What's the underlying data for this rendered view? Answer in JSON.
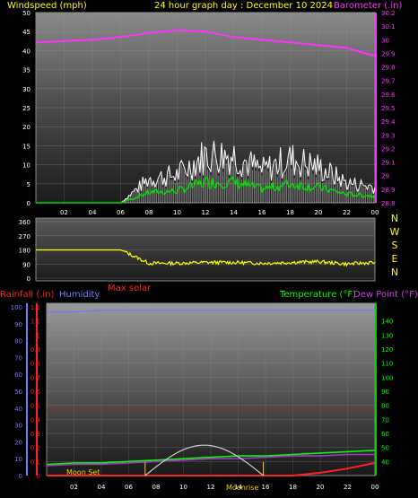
{
  "header": {
    "wind_title": "Windspeed (mph)",
    "graph_title": "24 hour graph day : December 10 2024",
    "baro_title": "Barometer (.in)"
  },
  "lower_header": {
    "rain_title": "Rainfall (.in)",
    "hum_title": "Humidity",
    "solar_title": "Max solar",
    "temp_title": "Temperature (°F)",
    "dew_title": "Dew Point (°F)"
  },
  "time_labels": [
    "02",
    "04",
    "06",
    "08",
    "10",
    "12",
    "14",
    "16",
    "18",
    "20",
    "22",
    "00"
  ],
  "compass_labels": [
    "N",
    "W",
    "S",
    "E",
    "N"
  ],
  "moon": {
    "set_label": "Moon Set",
    "rise_label": "Moonrise"
  },
  "colors": {
    "wind": "#ffffff",
    "gust": "#00dd00",
    "barometer": "#ff33ff",
    "direction": "#ffff00",
    "rain": "#ff2222",
    "humidity": "#7777ff",
    "temperature": "#00ff00",
    "dewpoint": "#aa33cc",
    "solar": "#cccccc",
    "compass": "#ffff00"
  },
  "chart_data": [
    {
      "type": "line",
      "name": "wind-barometer",
      "x": [
        "00",
        "02",
        "04",
        "06",
        "08",
        "10",
        "12",
        "14",
        "16",
        "18",
        "20",
        "22",
        "00"
      ],
      "left_axis": {
        "label": "Windspeed (mph)",
        "range": [
          0,
          50
        ],
        "ticks": [
          0,
          5,
          10,
          15,
          20,
          25,
          30,
          35,
          40,
          45,
          50
        ]
      },
      "right_axis": {
        "label": "Barometer (.in)",
        "range": [
          28.8,
          30.2
        ],
        "ticks": [
          "28.8",
          "28.9",
          "29",
          "29.1",
          "29.2",
          "29.3",
          "29.4",
          "29.5",
          "29.6",
          "29.7",
          "29.8",
          "29.9",
          "30",
          "30.1",
          "30.2"
        ]
      },
      "series": [
        {
          "name": "Barometer (.in)",
          "axis": "right",
          "values": [
            29.98,
            29.99,
            30.0,
            30.02,
            30.05,
            30.07,
            30.06,
            30.02,
            30.0,
            29.98,
            29.96,
            29.94,
            29.88
          ]
        },
        {
          "name": "Windspeed (mph)",
          "axis": "left",
          "values": [
            0,
            0,
            0,
            0,
            6,
            7,
            12,
            12,
            8,
            11,
            9,
            5,
            4
          ]
        }
      ],
      "grid": true
    },
    {
      "type": "line",
      "name": "wind-direction",
      "x": [
        "00",
        "02",
        "04",
        "06",
        "08",
        "10",
        "12",
        "14",
        "16",
        "18",
        "20",
        "22",
        "00"
      ],
      "left_axis": {
        "range": [
          0,
          360
        ],
        "ticks": [
          0,
          90,
          180,
          270,
          360
        ]
      },
      "series": [
        {
          "name": "Wind direction",
          "values": [
            180,
            180,
            180,
            180,
            95,
            95,
            100,
            100,
            95,
            100,
            105,
            90,
            100
          ]
        }
      ],
      "grid": true
    },
    {
      "type": "line",
      "name": "rain-humidity-temperature",
      "x": [
        "00",
        "02",
        "04",
        "06",
        "08",
        "10",
        "12",
        "14",
        "16",
        "18",
        "20",
        "22",
        "00"
      ],
      "rain_axis": {
        "label": "Rainfall (.in)",
        "range": [
          0,
          1.2
        ],
        "ticks": [
          "0",
          "0.1",
          "0.2",
          "0.3",
          "0.4",
          "0.5",
          "0.6",
          "0.7",
          "0.8",
          "0.9",
          "1",
          "1.1",
          "1.2"
        ]
      },
      "humidity_axis": {
        "label": "Humidity",
        "range": [
          0,
          100
        ],
        "ticks": [
          0,
          10,
          20,
          30,
          40,
          50,
          60,
          70,
          80,
          90,
          100
        ]
      },
      "temp_axis": {
        "label": "Temperature (°F)",
        "range": [
          30,
          150
        ],
        "ticks": [
          40,
          50,
          60,
          70,
          80,
          90,
          100,
          110,
          120,
          130,
          140
        ]
      },
      "series": [
        {
          "name": "Humidity",
          "axis": "humidity",
          "values": [
            97,
            97,
            98,
            98,
            98,
            98,
            98,
            98,
            98,
            98,
            98,
            98,
            98
          ]
        },
        {
          "name": "Temperature (°F)",
          "axis": "temp",
          "values": [
            38,
            39,
            39,
            40,
            41,
            42,
            43,
            44,
            44,
            45,
            46,
            47,
            48
          ]
        },
        {
          "name": "Dew Point (°F)",
          "axis": "temp",
          "values": [
            37,
            38,
            38,
            39,
            40,
            41,
            42,
            42,
            43,
            44,
            44,
            45,
            45
          ]
        },
        {
          "name": "Rainfall (.in)",
          "axis": "rain",
          "values": [
            0,
            0,
            0,
            0,
            0,
            0,
            0,
            0,
            0,
            0,
            0.02,
            0.05,
            0.09
          ]
        },
        {
          "name": "Max solar",
          "axis": "humidity",
          "values": [
            0,
            0,
            0,
            0,
            0,
            10,
            18,
            12,
            0,
            0,
            0,
            0,
            0
          ]
        }
      ],
      "reference_line": {
        "axis": "rain",
        "value": 0.47
      },
      "grid": true
    }
  ]
}
